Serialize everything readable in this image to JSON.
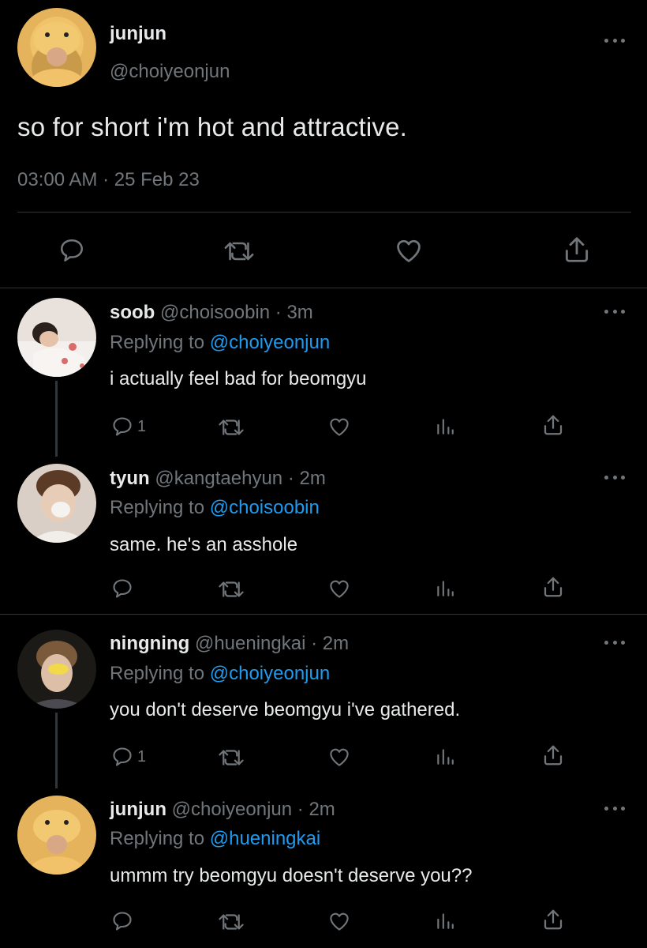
{
  "main": {
    "name": "junjun",
    "handle": "@choiyeonjun",
    "text": "so for short i'm hot and attractive.",
    "timestamp": "03:00 AM · 25 Feb 23"
  },
  "replies": [
    {
      "name": "soob",
      "handle": "@choisoobin",
      "time": "· 3m",
      "replying_prefix": "Replying to",
      "replying_to": "@choiyeonjun",
      "text": "i actually feel bad for beomgyu",
      "reply_count": "1"
    },
    {
      "name": "tyun",
      "handle": "@kangtaehyun",
      "time": "· 2m",
      "replying_prefix": "Replying to",
      "replying_to": "@choisoobin",
      "text": "same. he's an asshole",
      "reply_count": ""
    },
    {
      "name": "ningning",
      "handle": "@hueningkai",
      "time": "· 2m",
      "replying_prefix": "Replying to",
      "replying_to": "@choiyeonjun",
      "text": "you don't deserve beomgyu i've gathered.",
      "reply_count": "1"
    },
    {
      "name": "junjun",
      "handle": "@choiyeonjun",
      "time": "· 2m",
      "replying_prefix": "Replying to",
      "replying_to": "@hueningkai",
      "text": "ummm try beomgyu doesn't deserve you??",
      "reply_count": ""
    }
  ],
  "colors": {
    "background": "#000000",
    "text": "#e7e9ea",
    "muted": "#71767b",
    "link": "#1d9bf0"
  }
}
